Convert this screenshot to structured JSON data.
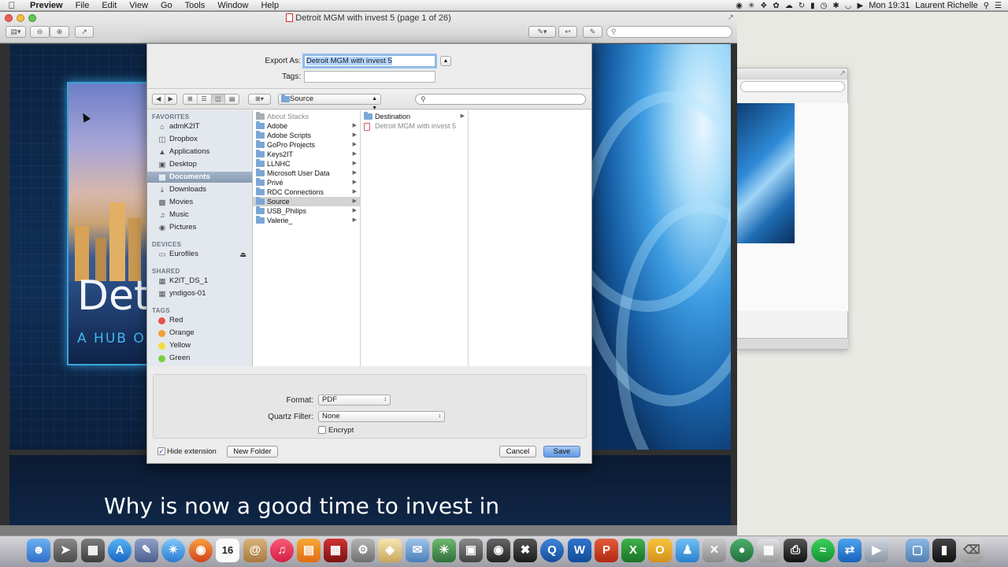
{
  "menubar": {
    "apple": "",
    "app_name": "Preview",
    "menus": [
      "File",
      "Edit",
      "View",
      "Go",
      "Tools",
      "Window",
      "Help"
    ],
    "clock": "Mon 19:31",
    "user": "Laurent Richelle"
  },
  "preview": {
    "window_title": "Detroit MGM with invest 5 (page 1 of 26)",
    "search_placeholder": ""
  },
  "slides": {
    "slide1_title": "Det",
    "slide1_subtitle": "A HUB OF",
    "slide2_heading": "Why is now a good time to invest in"
  },
  "save_sheet": {
    "export_as_label": "Export As:",
    "export_as_value": "Detroit MGM with invest 5",
    "tags_label": "Tags:",
    "location": "Source",
    "sidebar": {
      "favorites_header": "FAVORITES",
      "favorites": [
        {
          "label": "admK2IT",
          "icon": "home-icon"
        },
        {
          "label": "Dropbox",
          "icon": "folder-icon"
        },
        {
          "label": "Applications",
          "icon": "applications-icon"
        },
        {
          "label": "Desktop",
          "icon": "desktop-icon"
        },
        {
          "label": "Documents",
          "icon": "documents-icon"
        },
        {
          "label": "Downloads",
          "icon": "downloads-icon"
        },
        {
          "label": "Movies",
          "icon": "movies-icon"
        },
        {
          "label": "Music",
          "icon": "music-icon"
        },
        {
          "label": "Pictures",
          "icon": "pictures-icon"
        }
      ],
      "devices_header": "DEVICES",
      "devices": [
        {
          "label": "Eurofiles",
          "icon": "drive-icon"
        }
      ],
      "shared_header": "SHARED",
      "shared": [
        {
          "label": "K2IT_DS_1",
          "icon": "server-icon"
        },
        {
          "label": "yndigos-01",
          "icon": "server-icon"
        }
      ],
      "tags_header": "TAGS",
      "tags": [
        {
          "label": "Red",
          "color": "#e5534b"
        },
        {
          "label": "Orange",
          "color": "#f0a232"
        },
        {
          "label": "Yellow",
          "color": "#f2dc3a"
        },
        {
          "label": "Green",
          "color": "#7bcf3d"
        }
      ]
    },
    "column1": [
      "About Stacks",
      "Adobe",
      "Adobe Scripts",
      "GoPro Projects",
      "Keys2IT",
      "LLNHC",
      "Microsoft User Data",
      "Privé",
      "RDC Connections",
      "Source",
      "USB_Philips",
      "Valerie_"
    ],
    "column2": [
      "Destination",
      "Detroit MGM with invest 5"
    ],
    "format_label": "Format:",
    "format_value": "PDF",
    "quartz_label": "Quartz Filter:",
    "quartz_value": "None",
    "encrypt_label": "Encrypt",
    "hide_extension_label": "Hide extension",
    "new_folder_label": "New Folder",
    "cancel_label": "Cancel",
    "save_label": "Save"
  },
  "colors": {
    "accent": "#5f98e6",
    "sidebar_selected": "#8a9cb2"
  }
}
